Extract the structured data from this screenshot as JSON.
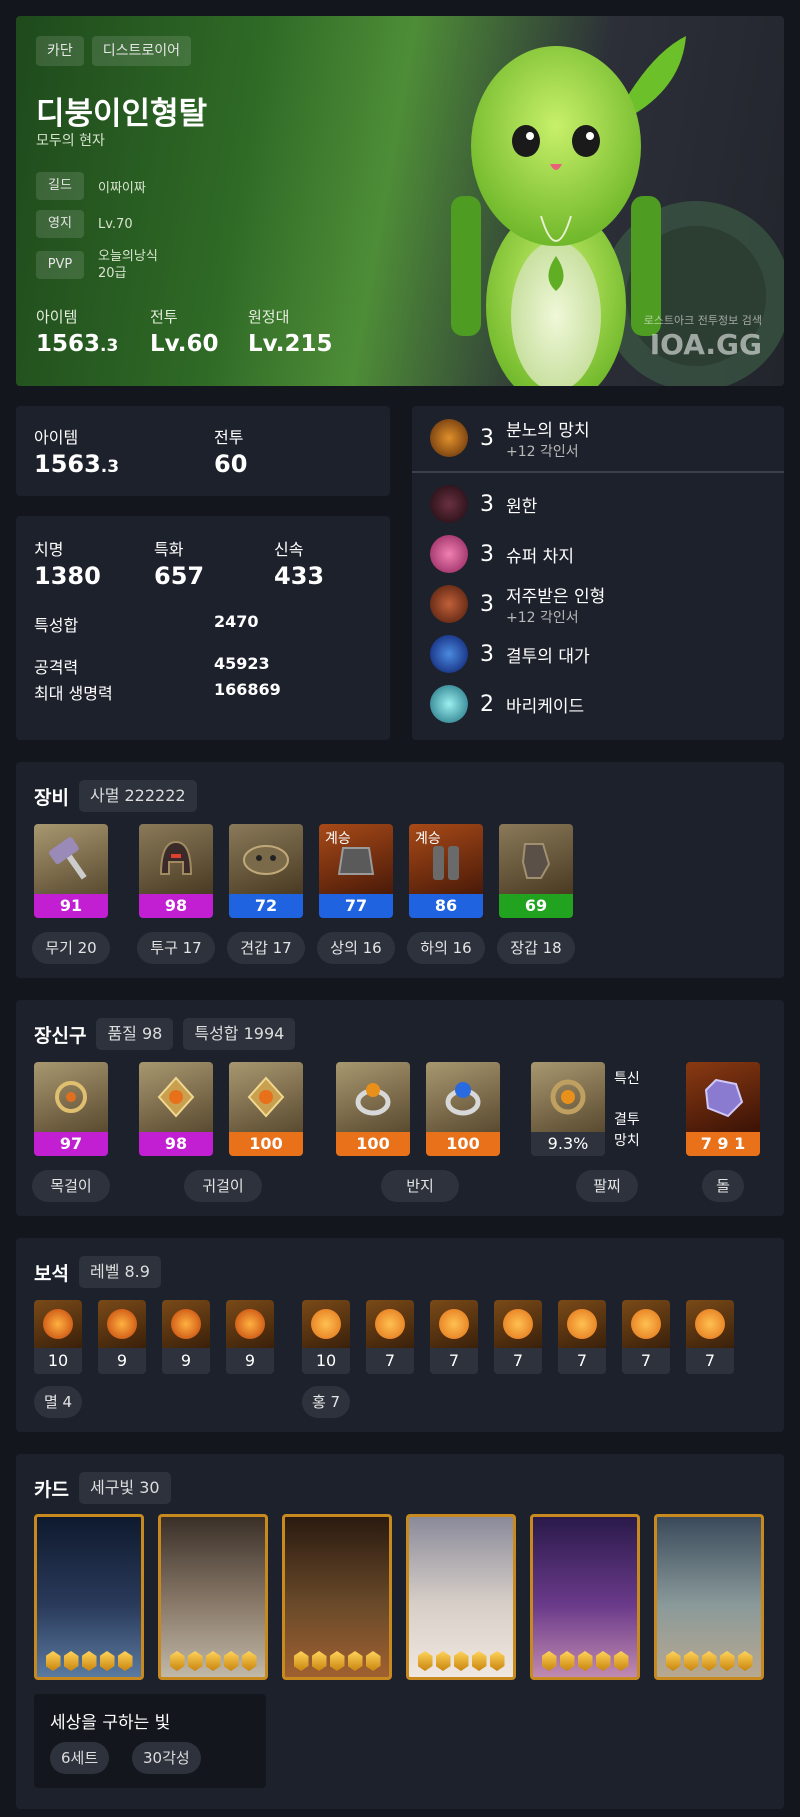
{
  "hero": {
    "server": "카단",
    "class": "디스트로이어",
    "name": "디붕이인형탈",
    "title": "모두의 현자",
    "info": [
      {
        "label": "길드",
        "value": "이짜이짜"
      },
      {
        "label": "영지",
        "value": "Lv.70"
      },
      {
        "label": "PVP",
        "value": "오늘의낭식\n20급"
      }
    ],
    "stats": [
      {
        "label": "아이템",
        "value": "1563",
        "decimal": ".3"
      },
      {
        "label": "전투",
        "value": "Lv.60",
        "decimal": ""
      },
      {
        "label": "원정대",
        "value": "Lv.215",
        "decimal": ""
      }
    ],
    "watermark": "IOA.GG",
    "watermark_sub": "로스트아크 전투정보 검색"
  },
  "summary": {
    "item_label": "아이템",
    "item_value": "1563",
    "item_decimal": ".3",
    "battle_label": "전투",
    "battle_value": "60"
  },
  "combat": {
    "crit_label": "치명",
    "crit": "1380",
    "spec_label": "특화",
    "spec": "657",
    "swift_label": "신속",
    "swift": "433",
    "total_label": "특성합",
    "total": "2470",
    "atk_label": "공격력",
    "atk": "45923",
    "hp_label": "최대 생명력",
    "hp": "166869"
  },
  "engravings": [
    {
      "level": "3",
      "name": "분노의 망치",
      "sub": "+12 각인서",
      "icon": "hammer-icon",
      "color": "#8a4a1a"
    },
    {
      "level": "3",
      "name": "원한",
      "sub": "",
      "icon": "grudge-icon",
      "color": "#3a1a22"
    },
    {
      "level": "3",
      "name": "슈퍼 차지",
      "sub": "",
      "icon": "super-charge-icon",
      "color": "#c0407a"
    },
    {
      "level": "3",
      "name": "저주받은 인형",
      "sub": "+12 각인서",
      "icon": "cursed-doll-icon",
      "color": "#7a2a10"
    },
    {
      "level": "3",
      "name": "결투의 대가",
      "sub": "",
      "icon": "duel-master-icon",
      "color": "#1a3aa0"
    },
    {
      "level": "2",
      "name": "바리케이드",
      "sub": "",
      "icon": "barricade-icon",
      "color": "#2a9aa8"
    }
  ],
  "equipment": {
    "title": "장비",
    "badge": "사멸 222222",
    "items": [
      {
        "value": "91",
        "bar": "#c21fd3",
        "bg": "#8a7a55",
        "label": "무기 20",
        "tag": "",
        "icon": "hammer-icon"
      },
      {
        "value": "98",
        "bar": "#c21fd3",
        "bg": "#7a6a4a",
        "label": "투구 17",
        "tag": "",
        "icon": "helmet-icon"
      },
      {
        "value": "72",
        "bar": "#1f63e0",
        "bg": "#7a6a4a",
        "label": "견갑 17",
        "tag": "",
        "icon": "shoulder-icon"
      },
      {
        "value": "77",
        "bar": "#1f63e0",
        "bg": "#8a3a10",
        "label": "상의 16",
        "tag": "계승",
        "icon": "chest-armor-icon"
      },
      {
        "value": "86",
        "bar": "#1f63e0",
        "bg": "#8a3a10",
        "label": "하의 16",
        "tag": "계승",
        "icon": "leg-armor-icon"
      },
      {
        "value": "69",
        "bar": "#22a320",
        "bg": "#7a6a4a",
        "label": "장갑 18",
        "tag": "",
        "icon": "gloves-icon"
      }
    ]
  },
  "accessories": {
    "title": "장신구",
    "quality": "품질 98",
    "stat_total": "특성합 1994",
    "items": [
      {
        "value": "97",
        "bar": "#c21fd3",
        "icon": "necklace-icon"
      },
      {
        "value": "98",
        "bar": "#c21fd3",
        "icon": "earring-icon"
      },
      {
        "value": "100",
        "bar": "#e8711a",
        "icon": "earring-icon"
      },
      {
        "value": "100",
        "bar": "#e8711a",
        "icon": "ring-icon"
      },
      {
        "value": "100",
        "bar": "#e8711a",
        "icon": "ring-icon"
      },
      {
        "value": "9.3%",
        "bar": "#2d323d",
        "icon": "bracelet-icon"
      },
      {
        "value": "7 9 1",
        "bar": "#e8711a",
        "icon": "ability-stone-icon"
      }
    ],
    "labels": [
      "목걸이",
      "귀걸이",
      "반지",
      "팔찌",
      "돌"
    ],
    "bracelet_stats": "특신",
    "bracelet_effects": "결투\n망치"
  },
  "gems": {
    "title": "보석",
    "badge": "레벨 8.9",
    "levels": [
      "10",
      "9",
      "9",
      "9",
      "10",
      "7",
      "7",
      "7",
      "7",
      "7",
      "7"
    ],
    "labels": [
      "멸 4",
      "홍 7"
    ]
  },
  "cards": {
    "title": "카드",
    "badge": "세구빛 30",
    "set_name": "세상을 구하는 빛",
    "set_count": "6세트",
    "awaken": "30각성",
    "colors": [
      [
        "#0e1a2e",
        "#2a3a5a",
        "#5a7aa0"
      ],
      [
        "#3a3028",
        "#8a7a6a",
        "#c0b8a8"
      ],
      [
        "#2a1a10",
        "#6a4a2a",
        "#a06030"
      ],
      [
        "#8a8a9a",
        "#d8d0c8",
        "#f0e8e0"
      ],
      [
        "#2a1a4a",
        "#6a3a8a",
        "#c08ab0"
      ],
      [
        "#3a4a5a",
        "#8a9a9a",
        "#b8a890"
      ]
    ]
  }
}
